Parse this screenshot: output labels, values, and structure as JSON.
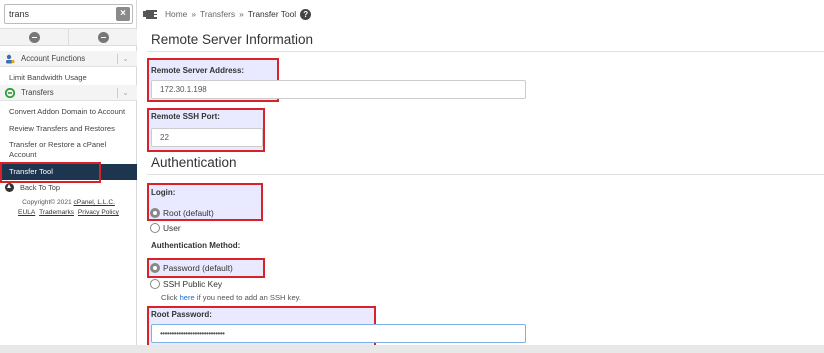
{
  "search": {
    "value": "trans",
    "clear_icon": "close-icon"
  },
  "sidebar": {
    "categories": {
      "account_functions": "Account Functions",
      "transfers": "Transfers"
    },
    "items": {
      "limit_bandwidth": "Limit Bandwidth Usage",
      "convert_addon": "Convert Addon Domain to Account",
      "review_transfers": "Review Transfers and Restores",
      "transfer_or_restore": "Transfer or Restore a cPanel Account",
      "transfer_tool": "Transfer Tool"
    },
    "back_to_top": "Back To Top",
    "copyright_prefix": "Copyright© 2021 ",
    "copyright_link": "cPanel, L.L.C.",
    "links": [
      "EULA",
      "Trademarks",
      "Privacy Policy"
    ]
  },
  "breadcrumb": {
    "home": "Home",
    "sep": "»",
    "transfers": "Transfers",
    "current": "Transfer Tool"
  },
  "sections": {
    "remote_server": "Remote Server Information",
    "authentication": "Authentication"
  },
  "fields": {
    "remote_address_label": "Remote Server Address:",
    "remote_address_value": "172.30.1.198",
    "ssh_port_label": "Remote SSH Port:",
    "ssh_port_value": "22",
    "login_label": "Login:",
    "login_root": "Root (default)",
    "login_user": "User",
    "auth_method_label": "Authentication Method:",
    "auth_password": "Password (default)",
    "auth_ssh_key": "SSH Public Key",
    "ssh_hint_prefix": "Click ",
    "ssh_hint_link": "here",
    "ssh_hint_suffix": " if you need to add an SSH key.",
    "root_password_label": "Root Password:",
    "root_password_value": "••••••••••••••••••••••••••••"
  },
  "colors": {
    "highlight_border": "#d7222a",
    "active_nav": "#1e3550",
    "transfers_icon": "#2e9e3a",
    "link": "#1a6fd0"
  }
}
